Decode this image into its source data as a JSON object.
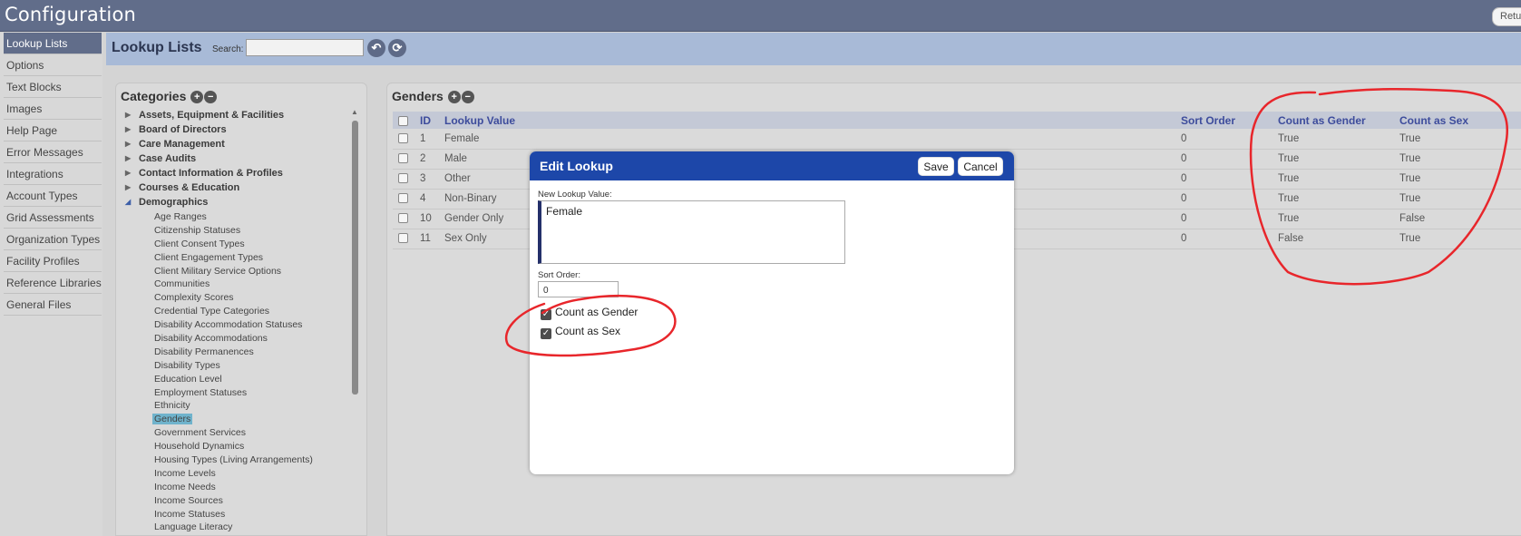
{
  "window": {
    "title": "Configuration",
    "return_label": "Return"
  },
  "sidebar": {
    "items": [
      {
        "label": "Lookup Lists"
      },
      {
        "label": "Options"
      },
      {
        "label": "Text Blocks"
      },
      {
        "label": "Images"
      },
      {
        "label": "Help Page"
      },
      {
        "label": "Error Messages"
      },
      {
        "label": "Integrations"
      },
      {
        "label": "Account Types"
      },
      {
        "label": "Grid Assessments"
      },
      {
        "label": "Organization Types"
      },
      {
        "label": "Facility Profiles"
      },
      {
        "label": "Reference Libraries"
      },
      {
        "label": "General Files"
      }
    ]
  },
  "header": {
    "title": "Lookup Lists",
    "search_label": "Search:",
    "search_value": ""
  },
  "categories": {
    "title": "Categories",
    "groups": [
      "Assets, Equipment & Facilities",
      "Board of Directors",
      "Care Management",
      "Case Audits",
      "Contact Information & Profiles",
      "Courses & Education",
      "Demographics"
    ],
    "demographics_items": [
      "Age Ranges",
      "Citizenship Statuses",
      "Client Consent Types",
      "Client Engagement Types",
      "Client Military Service Options",
      "Communities",
      "Complexity Scores",
      "Credential Type Categories",
      "Disability Accommodation Statuses",
      "Disability Accommodations",
      "Disability Permanences",
      "Disability Types",
      "Education Level",
      "Employment Statuses",
      "Ethnicity",
      "Genders",
      "Government Services",
      "Household Dynamics",
      "Housing Types (Living Arrangements)",
      "Income Levels",
      "Income Needs",
      "Income Sources",
      "Income Statuses",
      "Language Literacy"
    ]
  },
  "genders": {
    "title": "Genders",
    "columns": {
      "id": "ID",
      "value": "Lookup Value",
      "sort": "Sort Order",
      "gender": "Count as Gender",
      "sex": "Count as Sex"
    },
    "rows": [
      {
        "id": "1",
        "value": "Female",
        "sort": "0",
        "gender": "True",
        "sex": "True"
      },
      {
        "id": "2",
        "value": "Male",
        "sort": "0",
        "gender": "True",
        "sex": "True"
      },
      {
        "id": "3",
        "value": "Other",
        "sort": "0",
        "gender": "True",
        "sex": "True"
      },
      {
        "id": "4",
        "value": "Non-Binary",
        "sort": "0",
        "gender": "True",
        "sex": "True"
      },
      {
        "id": "10",
        "value": "Gender Only",
        "sort": "0",
        "gender": "True",
        "sex": "False"
      },
      {
        "id": "11",
        "value": "Sex Only",
        "sort": "0",
        "gender": "False",
        "sex": "True"
      }
    ]
  },
  "modal": {
    "title": "Edit Lookup",
    "save": "Save",
    "cancel": "Cancel",
    "value_label": "New Lookup Value:",
    "value": "Female",
    "sort_label": "Sort Order:",
    "sort_value": "0",
    "check_gender": "Count as Gender",
    "check_sex": "Count as Sex"
  },
  "colors": {
    "titlebar": "#616d8a",
    "header_band": "#a8bad7",
    "modal_header": "#1d47a9",
    "annotation": "#e8262b",
    "selected_item": "#6fb3cc"
  }
}
